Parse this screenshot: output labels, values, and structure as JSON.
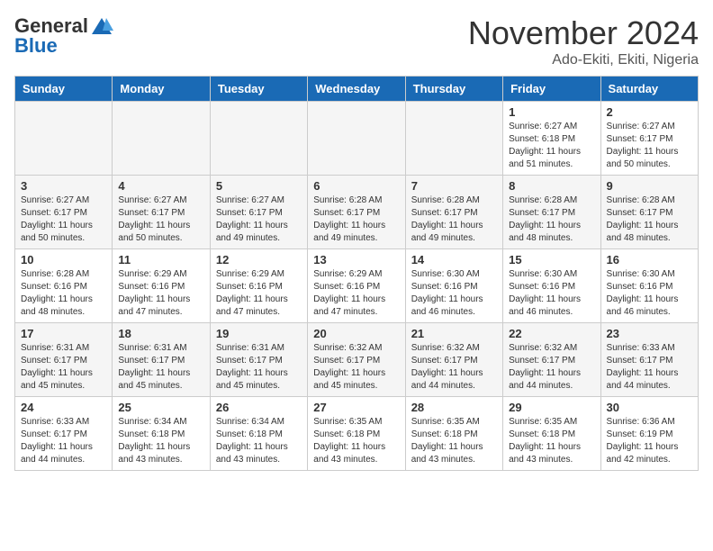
{
  "header": {
    "logo_general": "General",
    "logo_blue": "Blue",
    "month_title": "November 2024",
    "subtitle": "Ado-Ekiti, Ekiti, Nigeria"
  },
  "weekdays": [
    "Sunday",
    "Monday",
    "Tuesday",
    "Wednesday",
    "Thursday",
    "Friday",
    "Saturday"
  ],
  "weeks": [
    [
      {
        "day": "",
        "info": ""
      },
      {
        "day": "",
        "info": ""
      },
      {
        "day": "",
        "info": ""
      },
      {
        "day": "",
        "info": ""
      },
      {
        "day": "",
        "info": ""
      },
      {
        "day": "1",
        "info": "Sunrise: 6:27 AM\nSunset: 6:18 PM\nDaylight: 11 hours\nand 51 minutes."
      },
      {
        "day": "2",
        "info": "Sunrise: 6:27 AM\nSunset: 6:17 PM\nDaylight: 11 hours\nand 50 minutes."
      }
    ],
    [
      {
        "day": "3",
        "info": "Sunrise: 6:27 AM\nSunset: 6:17 PM\nDaylight: 11 hours\nand 50 minutes."
      },
      {
        "day": "4",
        "info": "Sunrise: 6:27 AM\nSunset: 6:17 PM\nDaylight: 11 hours\nand 50 minutes."
      },
      {
        "day": "5",
        "info": "Sunrise: 6:27 AM\nSunset: 6:17 PM\nDaylight: 11 hours\nand 49 minutes."
      },
      {
        "day": "6",
        "info": "Sunrise: 6:28 AM\nSunset: 6:17 PM\nDaylight: 11 hours\nand 49 minutes."
      },
      {
        "day": "7",
        "info": "Sunrise: 6:28 AM\nSunset: 6:17 PM\nDaylight: 11 hours\nand 49 minutes."
      },
      {
        "day": "8",
        "info": "Sunrise: 6:28 AM\nSunset: 6:17 PM\nDaylight: 11 hours\nand 48 minutes."
      },
      {
        "day": "9",
        "info": "Sunrise: 6:28 AM\nSunset: 6:17 PM\nDaylight: 11 hours\nand 48 minutes."
      }
    ],
    [
      {
        "day": "10",
        "info": "Sunrise: 6:28 AM\nSunset: 6:16 PM\nDaylight: 11 hours\nand 48 minutes."
      },
      {
        "day": "11",
        "info": "Sunrise: 6:29 AM\nSunset: 6:16 PM\nDaylight: 11 hours\nand 47 minutes."
      },
      {
        "day": "12",
        "info": "Sunrise: 6:29 AM\nSunset: 6:16 PM\nDaylight: 11 hours\nand 47 minutes."
      },
      {
        "day": "13",
        "info": "Sunrise: 6:29 AM\nSunset: 6:16 PM\nDaylight: 11 hours\nand 47 minutes."
      },
      {
        "day": "14",
        "info": "Sunrise: 6:30 AM\nSunset: 6:16 PM\nDaylight: 11 hours\nand 46 minutes."
      },
      {
        "day": "15",
        "info": "Sunrise: 6:30 AM\nSunset: 6:16 PM\nDaylight: 11 hours\nand 46 minutes."
      },
      {
        "day": "16",
        "info": "Sunrise: 6:30 AM\nSunset: 6:16 PM\nDaylight: 11 hours\nand 46 minutes."
      }
    ],
    [
      {
        "day": "17",
        "info": "Sunrise: 6:31 AM\nSunset: 6:17 PM\nDaylight: 11 hours\nand 45 minutes."
      },
      {
        "day": "18",
        "info": "Sunrise: 6:31 AM\nSunset: 6:17 PM\nDaylight: 11 hours\nand 45 minutes."
      },
      {
        "day": "19",
        "info": "Sunrise: 6:31 AM\nSunset: 6:17 PM\nDaylight: 11 hours\nand 45 minutes."
      },
      {
        "day": "20",
        "info": "Sunrise: 6:32 AM\nSunset: 6:17 PM\nDaylight: 11 hours\nand 45 minutes."
      },
      {
        "day": "21",
        "info": "Sunrise: 6:32 AM\nSunset: 6:17 PM\nDaylight: 11 hours\nand 44 minutes."
      },
      {
        "day": "22",
        "info": "Sunrise: 6:32 AM\nSunset: 6:17 PM\nDaylight: 11 hours\nand 44 minutes."
      },
      {
        "day": "23",
        "info": "Sunrise: 6:33 AM\nSunset: 6:17 PM\nDaylight: 11 hours\nand 44 minutes."
      }
    ],
    [
      {
        "day": "24",
        "info": "Sunrise: 6:33 AM\nSunset: 6:17 PM\nDaylight: 11 hours\nand 44 minutes."
      },
      {
        "day": "25",
        "info": "Sunrise: 6:34 AM\nSunset: 6:18 PM\nDaylight: 11 hours\nand 43 minutes."
      },
      {
        "day": "26",
        "info": "Sunrise: 6:34 AM\nSunset: 6:18 PM\nDaylight: 11 hours\nand 43 minutes."
      },
      {
        "day": "27",
        "info": "Sunrise: 6:35 AM\nSunset: 6:18 PM\nDaylight: 11 hours\nand 43 minutes."
      },
      {
        "day": "28",
        "info": "Sunrise: 6:35 AM\nSunset: 6:18 PM\nDaylight: 11 hours\nand 43 minutes."
      },
      {
        "day": "29",
        "info": "Sunrise: 6:35 AM\nSunset: 6:18 PM\nDaylight: 11 hours\nand 43 minutes."
      },
      {
        "day": "30",
        "info": "Sunrise: 6:36 AM\nSunset: 6:19 PM\nDaylight: 11 hours\nand 42 minutes."
      }
    ]
  ]
}
